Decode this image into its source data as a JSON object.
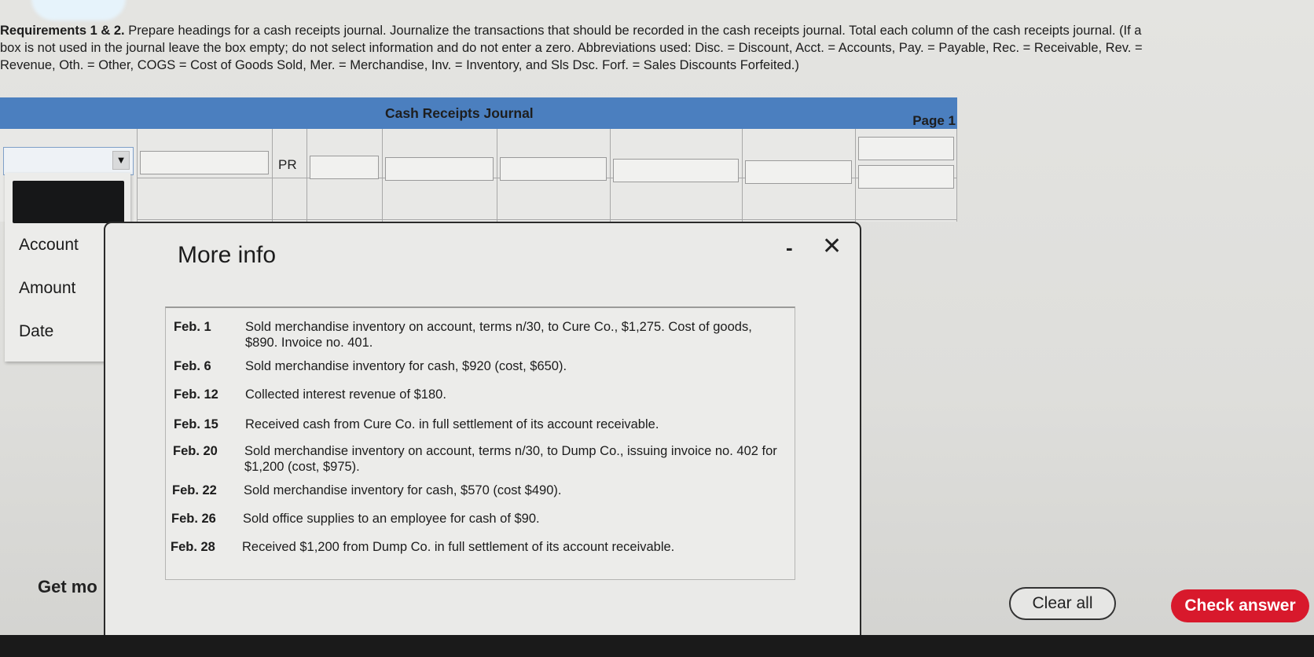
{
  "requirements": {
    "label": "Requirements 1 & 2.",
    "line1": " Prepare headings for a cash receipts journal. Journalize the transactions that should be recorded in the cash receipts journal. Total each column of the cash receipts journal. (If a",
    "line2": "box is not used in the journal leave the box empty; do not select information and do not enter a zero. Abbreviations used: Disc. = Discount, Acct. = Accounts, Pay. = Payable, Rec. = Receivable, Rev. =",
    "line3": "Revenue, Oth. = Other, COGS = Cost of Goods Sold, Mer. = Merchandise, Inv. = Inventory, and Sls Dsc. Forf. = Sales Discounts Forfeited.)"
  },
  "journal": {
    "title": "Cash Receipts Journal",
    "page": "Page 1",
    "pr_label": "PR"
  },
  "dropdown": {
    "selected": "",
    "arrow": "▼",
    "options": [
      "Account",
      "Amount",
      "Date"
    ]
  },
  "modal": {
    "title": "More info",
    "minimize": "-",
    "close": "✕",
    "transactions": [
      {
        "date": "Feb. 1",
        "text": "Sold merchandise inventory on account, terms n/30, to Cure Co., $1,275. Cost of goods, $890. Invoice no. 401."
      },
      {
        "date": "Feb. 6",
        "text": "Sold merchandise inventory for cash, $920 (cost, $650)."
      },
      {
        "date": "Feb. 12",
        "text": "Collected interest revenue of $180."
      },
      {
        "date": "Feb. 15",
        "text": "Received cash from Cure Co. in full settlement of its account receivable."
      },
      {
        "date": "Feb. 20",
        "text": "Sold merchandise inventory on account, terms n/30, to Dump Co., issuing invoice no. 402 for $1,200 (cost, $975)."
      },
      {
        "date": "Feb. 22",
        "text": "Sold merchandise inventory for cash, $570 (cost $490)."
      },
      {
        "date": "Feb. 26",
        "text": "Sold office supplies to an employee for cash of $90."
      },
      {
        "date": "Feb. 28",
        "text": "Received $1,200 from Dump Co. in full settlement of its account receivable."
      }
    ]
  },
  "footer": {
    "get_more": "Get mo",
    "clear_all": "Clear all",
    "check_answer": "Check answer"
  }
}
